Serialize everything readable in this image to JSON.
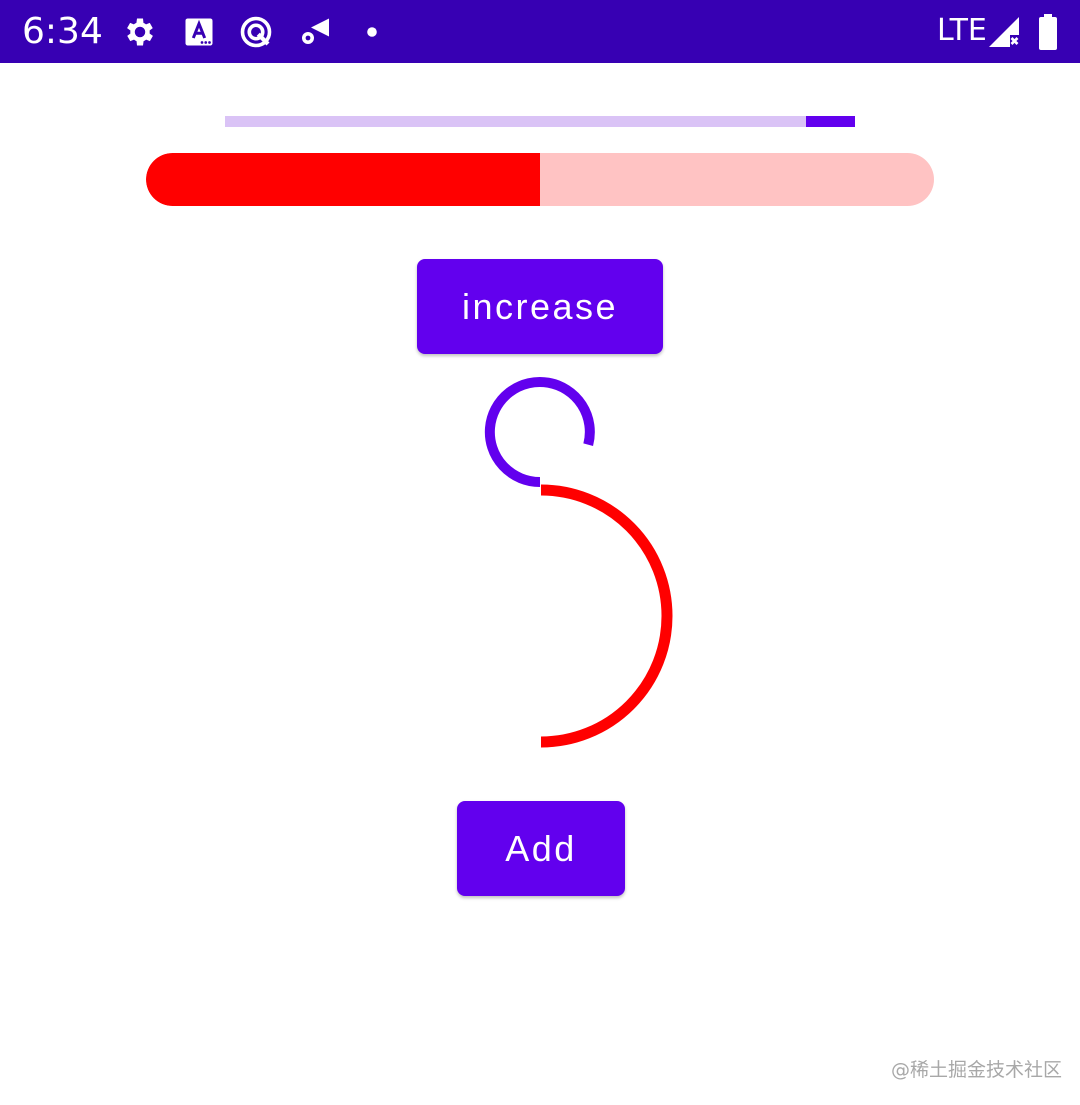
{
  "status_bar": {
    "time": "6:34",
    "network": "LTE",
    "background": "#3700b3",
    "icons": [
      "gear-icon",
      "app-a-icon",
      "data-saver-icon",
      "wifi-settings-icon",
      "notification-dot-icon",
      "signal-icon",
      "battery-icon"
    ]
  },
  "progress": {
    "linear": {
      "progress": 1.0,
      "secondary_segment": [
        0.923,
        1.0
      ],
      "track_color": "#dac3f6",
      "indicator_color": "#6200ee"
    },
    "rounded": {
      "progress": 0.5,
      "track_color": "#ffc3c3",
      "fill_color": "#ff0000"
    }
  },
  "buttons": {
    "increase_label": "increase",
    "add_label": "Add",
    "color": "#6200ee"
  },
  "arcs": {
    "small_arc": {
      "color": "#6200ee",
      "sweep_degrees": 275
    },
    "large_arc": {
      "color": "#ff0000",
      "sweep_degrees": 180
    }
  },
  "watermark": "@稀土掘金技术社区"
}
